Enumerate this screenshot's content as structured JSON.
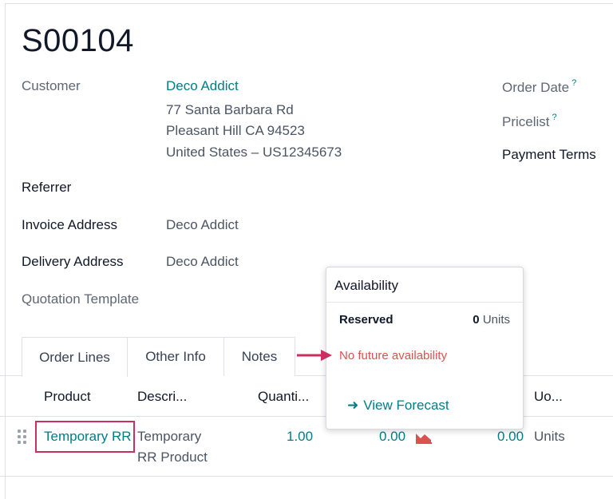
{
  "order": {
    "name": "S00104",
    "customer_label": "Customer",
    "customer_name": "Deco Addict",
    "address_line1": "77 Santa Barbara Rd",
    "address_line2": "Pleasant Hill CA 94523",
    "address_line3": "United States – US12345673",
    "referrer_label": "Referrer",
    "invoice_label": "Invoice Address",
    "invoice_value": "Deco Addict",
    "delivery_label": "Delivery Address",
    "delivery_value": "Deco Addict",
    "template_label": "Quotation Template",
    "order_date_label": "Order Date",
    "pricelist_label": "Pricelist",
    "payment_terms_label": "Payment Terms",
    "help_mark": "?"
  },
  "tabs": [
    {
      "label": "Order Lines",
      "active": true
    },
    {
      "label": "Other Info",
      "active": false
    },
    {
      "label": "Notes",
      "active": false
    }
  ],
  "table": {
    "headers": {
      "product": "Product",
      "description": "Descri...",
      "quantity": "Quanti...",
      "uom": "Uo..."
    },
    "row": {
      "product": "Temporary RR",
      "description_line1": "Temporary",
      "description_line2": "RR Product",
      "quantity": "1.00",
      "delivered": "0.00",
      "invoiced": "0.00",
      "uom": "Units"
    }
  },
  "popover": {
    "title": "Availability",
    "reserved_label": "Reserved",
    "reserved_qty": "0",
    "reserved_unit": "Units",
    "no_future": "No future availability",
    "forecast_label": "View Forecast"
  },
  "colors": {
    "link": "#017e84",
    "warning": "#d9534f",
    "annotation": "#c8305f"
  },
  "icons": [
    "drag-handle-icon",
    "forecast-chart-icon",
    "arrow-right-icon",
    "annotation-arrow-icon"
  ]
}
